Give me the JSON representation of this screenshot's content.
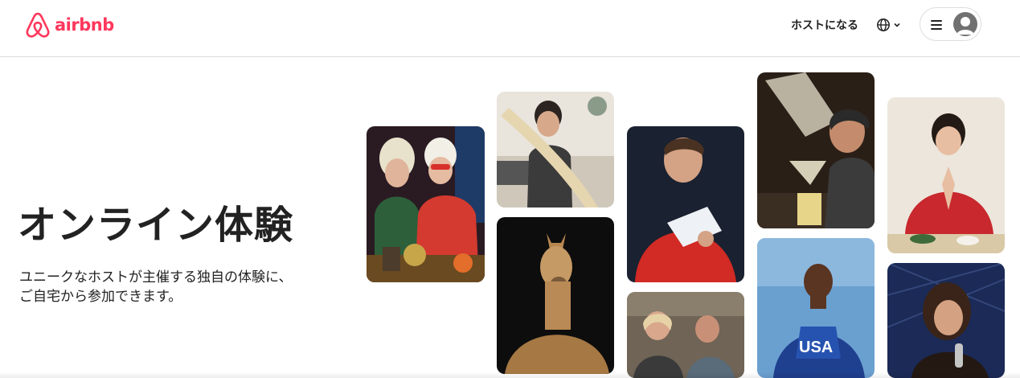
{
  "header": {
    "logo_text": "airbnb",
    "host_link": "ホストになる",
    "language_icon": "globe-icon",
    "menu_icon": "hamburger-icon",
    "profile_icon": "user-avatar-icon"
  },
  "hero": {
    "title": "オンライン体験",
    "subtitle_line1": "ユニークなホストが主催する独自の体験に、",
    "subtitle_line2": "ご自宅から参加できます。"
  },
  "colors": {
    "brand": "#ff385c",
    "text": "#222222",
    "border": "#dddddd"
  }
}
